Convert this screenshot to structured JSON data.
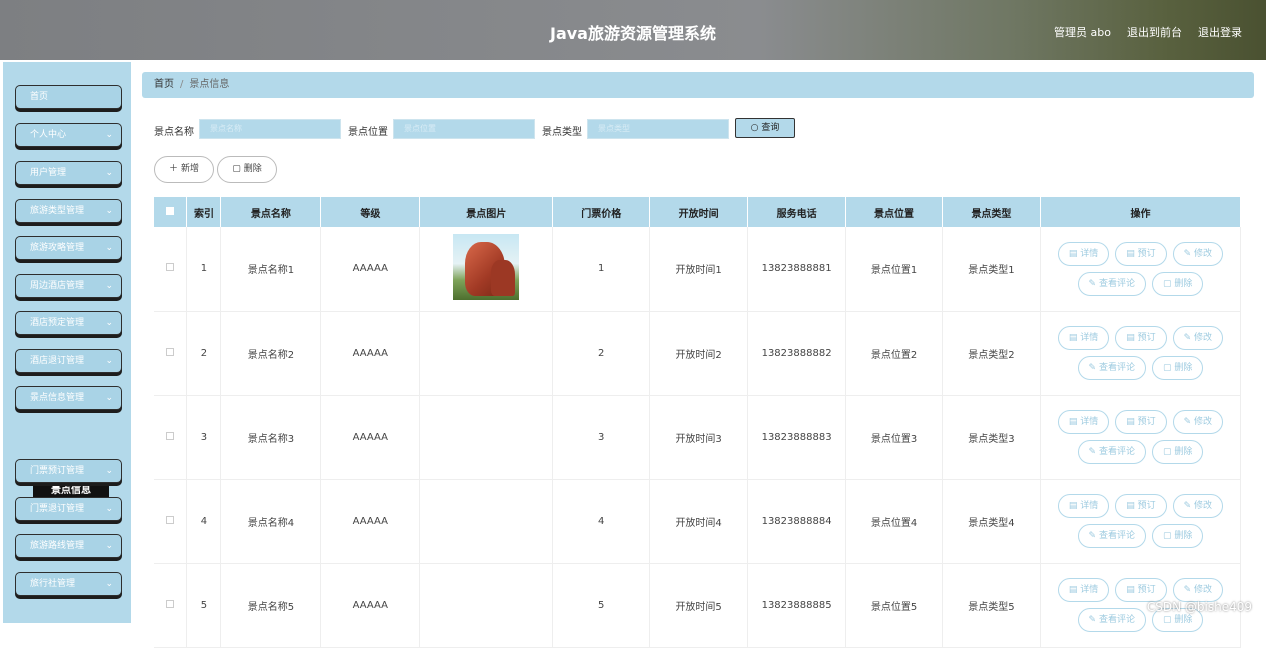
{
  "header": {
    "title": "Java旅游资源管理系统",
    "admin": "管理员 abo",
    "back_front": "退出到前台",
    "logout": "退出登录"
  },
  "sidebar": {
    "items": [
      {
        "label": "首页",
        "chevron": false
      },
      {
        "label": "个人中心",
        "chevron": true
      },
      {
        "label": "用户管理",
        "chevron": true
      },
      {
        "label": "旅游类型管理",
        "chevron": true
      },
      {
        "label": "旅游攻略管理",
        "chevron": true
      },
      {
        "label": "周边酒店管理",
        "chevron": true
      },
      {
        "label": "酒店预定管理",
        "chevron": true
      },
      {
        "label": "酒店退订管理",
        "chevron": true
      },
      {
        "label": "景点信息管理",
        "chevron": true
      },
      {
        "label": "门票预订管理",
        "chevron": true
      },
      {
        "label": "门票退订管理",
        "chevron": true
      },
      {
        "label": "旅游路线管理",
        "chevron": true
      },
      {
        "label": "旅行社管理",
        "chevron": true
      }
    ],
    "active_sub": "景点信息"
  },
  "breadcrumb": {
    "home": "首页",
    "current": "景点信息"
  },
  "search": {
    "name_label": "景点名称",
    "name_placeholder": "景点名称",
    "location_label": "景点位置",
    "location_placeholder": "景点位置",
    "type_label": "景点类型",
    "type_placeholder": "景点类型",
    "query_label": "查询"
  },
  "actions": {
    "add": "新增",
    "delete": "删除"
  },
  "table": {
    "headers": [
      "索引",
      "景点名称",
      "等级",
      "景点图片",
      "门票价格",
      "开放时间",
      "服务电话",
      "景点位置",
      "景点类型",
      "操作"
    ],
    "rows": [
      {
        "index": "1",
        "name": "景点名称1",
        "level": "AAAAA",
        "price": "1",
        "time": "开放时间1",
        "phone": "13823888881",
        "location": "景点位置1",
        "type": "景点类型1",
        "has_image": true
      },
      {
        "index": "2",
        "name": "景点名称2",
        "level": "AAAAA",
        "price": "2",
        "time": "开放时间2",
        "phone": "13823888882",
        "location": "景点位置2",
        "type": "景点类型2",
        "has_image": false
      },
      {
        "index": "3",
        "name": "景点名称3",
        "level": "AAAAA",
        "price": "3",
        "time": "开放时间3",
        "phone": "13823888883",
        "location": "景点位置3",
        "type": "景点类型3",
        "has_image": false
      },
      {
        "index": "4",
        "name": "景点名称4",
        "level": "AAAAA",
        "price": "4",
        "time": "开放时间4",
        "phone": "13823888884",
        "location": "景点位置4",
        "type": "景点类型4",
        "has_image": false
      },
      {
        "index": "5",
        "name": "景点名称5",
        "level": "AAAAA",
        "price": "5",
        "time": "开放时间5",
        "phone": "13823888885",
        "location": "景点位置5",
        "type": "景点类型5",
        "has_image": false
      }
    ],
    "ops": {
      "detail": "详情",
      "book": "预订",
      "edit": "修改",
      "comments": "查看评论",
      "delete": "删除"
    }
  },
  "watermark": "CSDN @bishe409"
}
